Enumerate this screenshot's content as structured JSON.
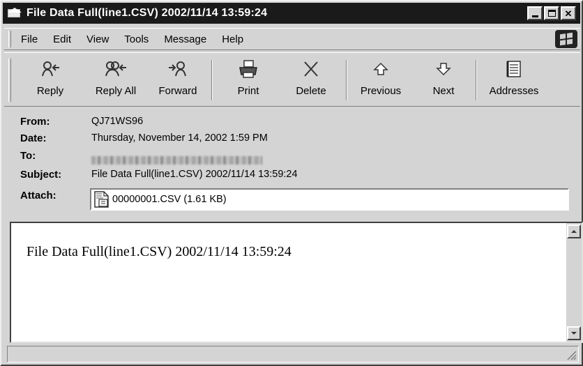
{
  "window": {
    "title": "File Data Full(line1.CSV) 2002/11/14 13:59:24"
  },
  "menu": {
    "items": [
      "File",
      "Edit",
      "View",
      "Tools",
      "Message",
      "Help"
    ]
  },
  "toolbar": {
    "buttons": [
      {
        "label": "Reply",
        "icon": "reply-icon"
      },
      {
        "label": "Reply All",
        "icon": "reply-all-icon"
      },
      {
        "label": "Forward",
        "icon": "forward-icon"
      },
      {
        "label": "Print",
        "icon": "printer-icon"
      },
      {
        "label": "Delete",
        "icon": "delete-x-icon"
      },
      {
        "label": "Previous",
        "icon": "up-arrow-icon"
      },
      {
        "label": "Next",
        "icon": "down-arrow-icon"
      },
      {
        "label": "Addresses",
        "icon": "address-book-icon"
      }
    ]
  },
  "header": {
    "from_label": "From:",
    "from_value": "QJ71WS96",
    "date_label": "Date:",
    "date_value": "Thursday, November 14, 2002 1:59 PM",
    "to_label": "To:",
    "subject_label": "Subject:",
    "subject_value": "File Data Full(line1.CSV) 2002/11/14 13:59:24",
    "attach_label": "Attach:",
    "attachment_name": "00000001.CSV (1.61 KB)"
  },
  "message": {
    "body": "File Data Full(line1.CSV) 2002/11/14 13:59:24"
  },
  "colors": {
    "titlebar_bg": "#1a1a1a",
    "chrome_bg": "#d4d4d4"
  }
}
